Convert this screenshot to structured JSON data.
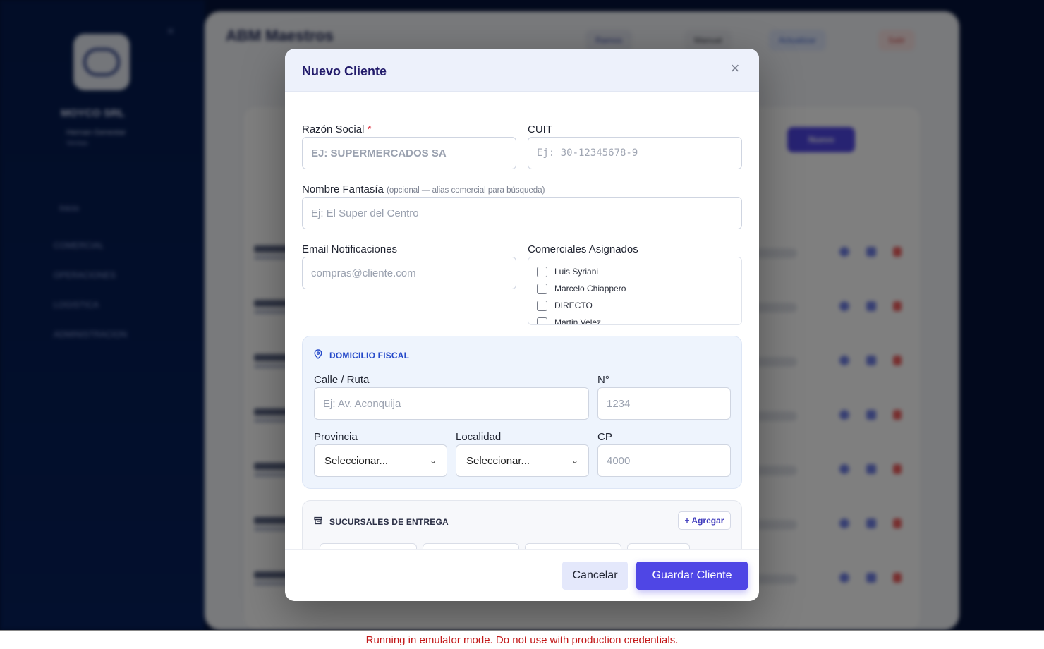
{
  "background": {
    "company": "MOYCO SRL",
    "user": "Hernan Genestar",
    "role": "Ventas",
    "page_title": "ABM Maestros",
    "nav": [
      "Inicio",
      "COMERCIAL",
      "OPERACIONES",
      "LOGISTICA",
      "ADMINISTRACION"
    ],
    "topbar": [
      "Ramos",
      "Manual",
      "Actualizar",
      "Salir"
    ],
    "new_button": "Nuevo"
  },
  "modal": {
    "title": "Nuevo Cliente",
    "close_icon": "close-icon",
    "razon_social": {
      "label": "Razón Social",
      "required_mark": "*",
      "placeholder": "EJ: SUPERMERCADOS SA"
    },
    "cuit": {
      "label": "CUIT",
      "placeholder": "Ej: 30-12345678-9"
    },
    "nombre_fantasia": {
      "label": "Nombre Fantasía",
      "hint": "(opcional — alias comercial para búsqueda)",
      "placeholder": "Ej: El Super del Centro"
    },
    "email": {
      "label": "Email Notificaciones",
      "placeholder": "compras@cliente.com"
    },
    "comerciales": {
      "label": "Comerciales Asignados",
      "options": [
        "Luis Syriani",
        "Marcelo Chiappero",
        "DIRECTO",
        "Martin Velez"
      ]
    },
    "domicilio": {
      "title": "DOMICILIO FISCAL",
      "icon": "map-pin-icon",
      "calle": {
        "label": "Calle / Ruta",
        "placeholder": "Ej: Av. Aconquija"
      },
      "numero": {
        "label": "N°",
        "placeholder": "1234"
      },
      "provincia": {
        "label": "Provincia",
        "value": "Seleccionar..."
      },
      "localidad": {
        "label": "Localidad",
        "value": "Seleccionar..."
      },
      "cp": {
        "label": "CP",
        "placeholder": "4000"
      }
    },
    "sucursales": {
      "title": "SUCURSALES DE ENTREGA",
      "icon": "store-icon",
      "add_label": "+ Agregar"
    },
    "footer": {
      "cancel_label": "Cancelar",
      "save_label": "Guardar Cliente"
    }
  },
  "emulator_notice": "Running in emulator mode. Do not use with production credentials.",
  "colors": {
    "primary": "#4f46e5",
    "title": "#231c6b",
    "section_blue": "#2549c9",
    "required": "#e0424f",
    "notice": "#c21818"
  }
}
